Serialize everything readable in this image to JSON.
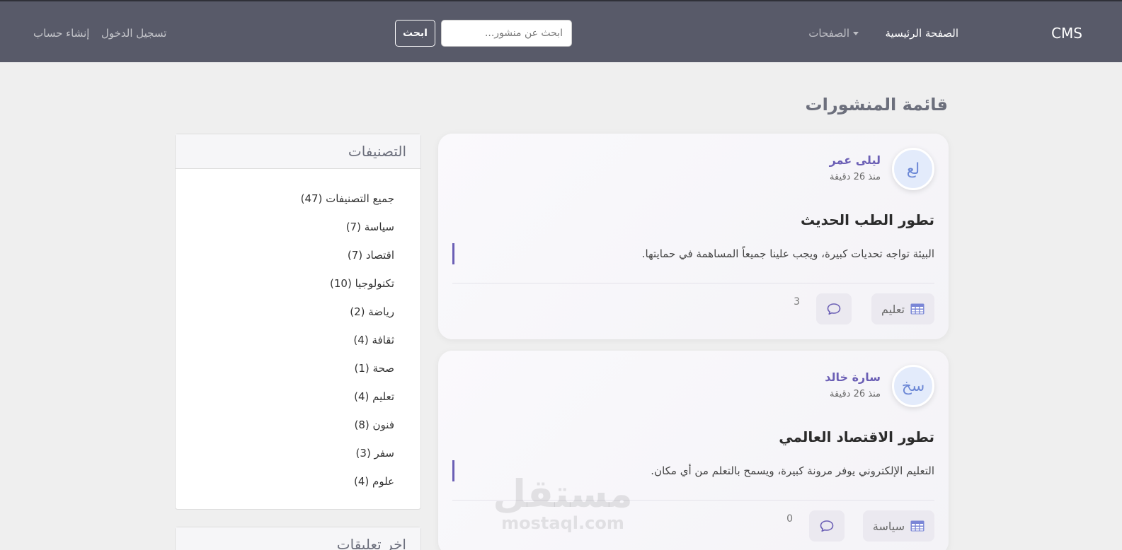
{
  "nav": {
    "brand": "CMS",
    "home": "الصفحة الرئيسية",
    "pages": "الصفحات",
    "search_placeholder": "ابحث عن منشور...",
    "search_button": "ابحث",
    "login": "تسجيل الدخول",
    "register": "إنشاء حساب"
  },
  "page_title": "قائمة المنشورات",
  "posts": [
    {
      "avatar": "لع",
      "author": "ليلى عمر",
      "time": "منذ 26 دقيقة",
      "title": "تطور الطب الحديث",
      "excerpt": "البيئة تواجه تحديات كبيرة، ويجب علينا جميعاً المساهمة في حمايتها.",
      "category": "تعليم",
      "comments": "3"
    },
    {
      "avatar": "سخ",
      "author": "سارة خالد",
      "time": "منذ 26 دقيقة",
      "title": "تطور الاقتصاد العالمي",
      "excerpt": "التعليم الإلكتروني يوفر مرونة كبيرة، ويسمح بالتعلم من أي مكان.",
      "category": "سياسة",
      "comments": "0"
    }
  ],
  "categories_panel": {
    "title": "التصنيفات",
    "items": [
      "جميع التصنيفات (47)",
      "سياسة (7)",
      "اقتصاد (7)",
      "تكنولوجيا (10)",
      "رياضة (2)",
      "ثقافة (4)",
      "صحة (1)",
      "تعليم (4)",
      "فنون (8)",
      "سفر (3)",
      "علوم (4)"
    ]
  },
  "comments_panel": {
    "title": "اخر تعليقات"
  },
  "watermark": {
    "arabic": "مستقل",
    "latin": "mostaql.com"
  },
  "colors": {
    "navbar": "#585a69",
    "accent": "#6b5fb5",
    "avatar_bg": "#e3ebfb"
  }
}
